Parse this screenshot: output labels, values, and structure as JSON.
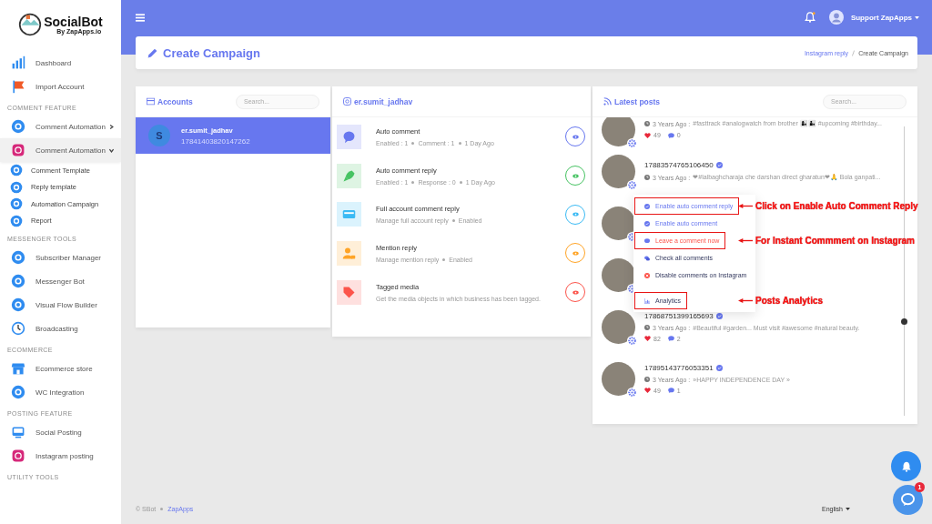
{
  "sidebar": {
    "logo": {
      "name": "SocialBot",
      "tagline": "By ZapApps.io"
    },
    "sections": [
      {
        "items": [
          {
            "label": "Dashboard",
            "selected": false
          },
          {
            "label": "Import Account",
            "selected": false
          }
        ]
      },
      {
        "heading": "COMMENT FEATURE",
        "items": [
          {
            "label": "Comment Automation",
            "selected": false,
            "expanded": false
          },
          {
            "label": "Comment Automation",
            "selected": true,
            "expanded": true,
            "children": [
              {
                "label": "Comment Template"
              },
              {
                "label": "Reply template"
              },
              {
                "label": "Automation Campaign"
              },
              {
                "label": "Report"
              }
            ]
          }
        ]
      },
      {
        "heading": "MESSENGER TOOLS",
        "items": [
          {
            "label": "Subscriber Manager",
            "selected": false
          },
          {
            "label": "Messenger Bot",
            "selected": false
          },
          {
            "label": "Visual Flow Builder",
            "selected": false
          },
          {
            "label": "Broadcasting",
            "selected": false
          }
        ]
      },
      {
        "heading": "ECOMMERCE",
        "items": [
          {
            "label": "Ecommerce store",
            "selected": false
          },
          {
            "label": "WC Integration",
            "selected": false
          }
        ]
      },
      {
        "heading": "POSTING FEATURE",
        "items": [
          {
            "label": "Social Posting",
            "selected": false
          },
          {
            "label": "Instagram posting",
            "selected": false
          }
        ]
      },
      {
        "heading": "UTILITY TOOLS"
      }
    ]
  },
  "topbar": {
    "user": "Support ZapApps",
    "has_notification": true
  },
  "page_header": {
    "title": "Create Campaign",
    "breadcrumb": [
      "Instagram reply",
      "Create Campaign"
    ]
  },
  "accounts": {
    "title": "Accounts",
    "search": {
      "placeholder": "Search..."
    },
    "items": [
      {
        "initial": "S",
        "name": "er.sumit_jadhav",
        "id": "17841403820147262",
        "selected": true
      }
    ]
  },
  "campaigns": {
    "title": "er.sumit_jadhav",
    "items": [
      {
        "color": "#6777ef",
        "title": "Auto comment",
        "meta": [
          "Enabled : 1",
          "Comment : 1",
          "1 Day Ago"
        ]
      },
      {
        "color": "#47c363",
        "title": "Auto comment reply",
        "meta": [
          "Enabled : 1",
          "Response : 0",
          "1 Day Ago"
        ]
      },
      {
        "color": "#3abaf4",
        "title": "Full account comment reply",
        "meta": [
          "Manage full account reply",
          "Enabled"
        ]
      },
      {
        "color": "#ffa426",
        "title": "Mention reply",
        "meta": [
          "Manage mention reply",
          "Enabled"
        ]
      },
      {
        "color": "#fc544b",
        "title": "Tagged media",
        "meta": [
          "Get the media objects in which business has been tagged."
        ]
      }
    ]
  },
  "posts": {
    "title": "Latest posts",
    "search": {
      "placeholder": "Search..."
    },
    "items": [
      {
        "kind": "post",
        "time": "3 Years Ago :",
        "caption": "#fasttrack #analogwatch from brother 👩‍👦👨‍👦 #upcoming #birthday...",
        "likes": "49",
        "comments": "0"
      },
      {
        "kind": "post",
        "id": "17883574765106450",
        "time": "3 Years Ago :",
        "caption": "❤#lalbaghcharaja che darshan direct gharatun❤🙏 Bola ganpati..."
      },
      {
        "kind": "covered"
      },
      {
        "kind": "covered"
      },
      {
        "kind": "post",
        "id": "17868751399165693",
        "time": "3 Years Ago :",
        "caption": "#Beautiful #garden... Must visit #awesome #natural beauty.",
        "likes": "82",
        "comments": "2"
      },
      {
        "kind": "post",
        "id": "17895143776053351",
        "time": "3 Years Ago :",
        "caption": "»HAPPY INDEPENDENCE DAY »",
        "likes": "49",
        "comments": "1"
      }
    ]
  },
  "post_menu": {
    "items": [
      {
        "kind": "enable",
        "label": "Enable auto comment reply",
        "callout": "Click on Enable Auto Comment Reply"
      },
      {
        "kind": "enable",
        "label": "Enable auto comment"
      },
      {
        "kind": "danger",
        "label": "Leave a comment now",
        "callout": "For Instant Commment on Instagram"
      },
      {
        "kind": "plain",
        "label": "Check all comments"
      },
      {
        "kind": "plain",
        "label": "Disable comments on Instagram"
      },
      {
        "kind": "plain",
        "label": "Analytics",
        "callout": "Posts Analytics"
      }
    ]
  },
  "footer": {
    "copyright": "© SBot",
    "link": "ZapApps",
    "language": "English"
  },
  "chat_badge": "1"
}
